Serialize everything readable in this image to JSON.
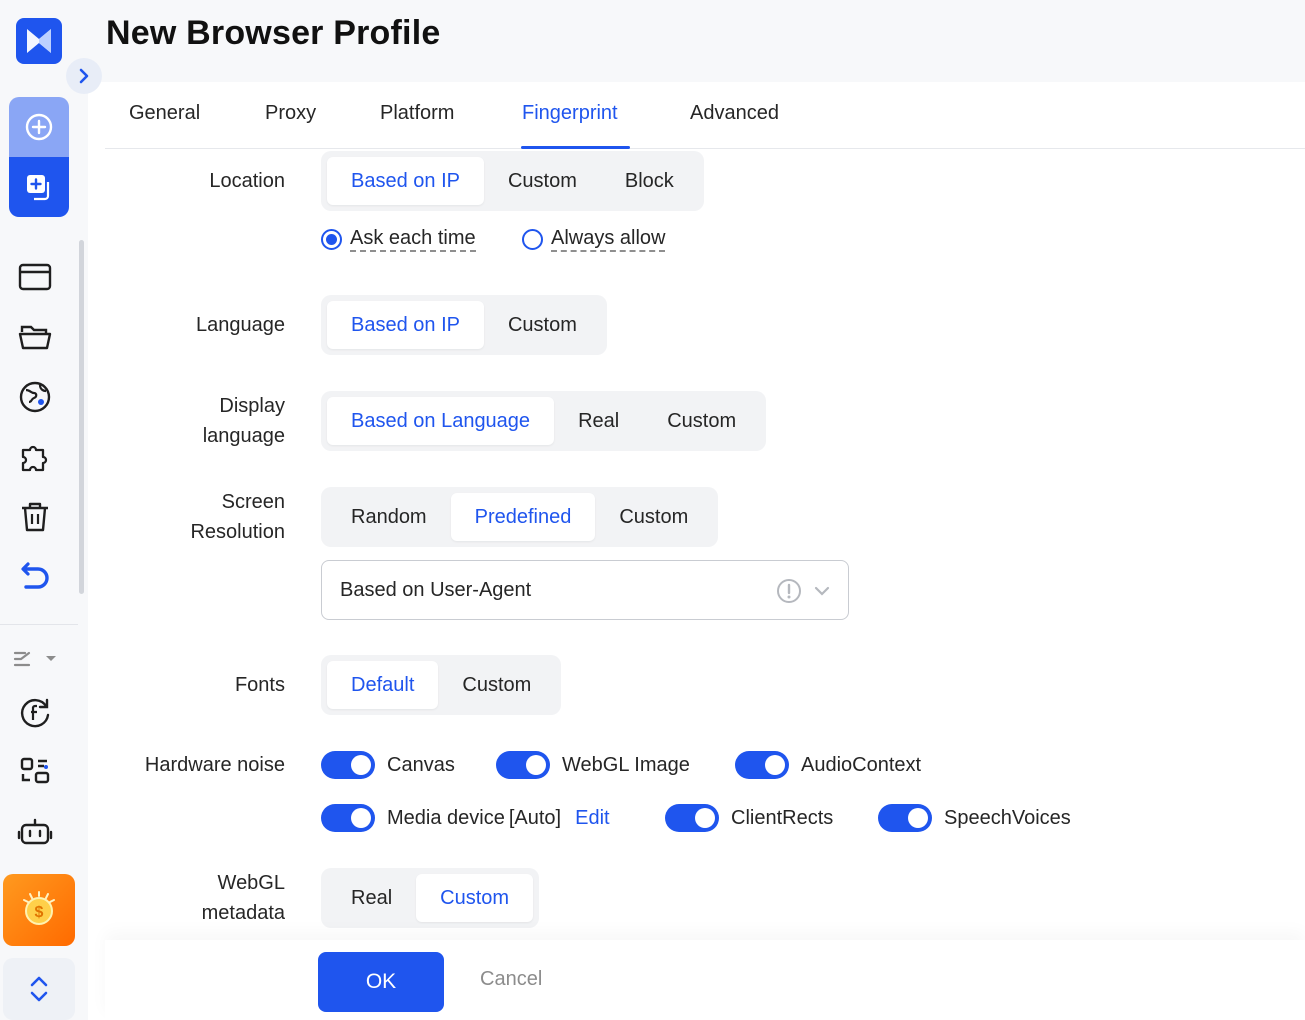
{
  "window": {
    "title": "New Browser Profile"
  },
  "tabs": [
    {
      "label": "General"
    },
    {
      "label": "Proxy"
    },
    {
      "label": "Platform"
    },
    {
      "label": "Fingerprint",
      "active": true
    },
    {
      "label": "Advanced"
    }
  ],
  "location": {
    "label": "Location",
    "options": [
      "Based on IP",
      "Custom",
      "Block"
    ],
    "selected": "Based on IP",
    "permission": {
      "options": [
        "Ask each time",
        "Always allow"
      ],
      "selected": "Ask each time"
    }
  },
  "language": {
    "label": "Language",
    "options": [
      "Based on IP",
      "Custom"
    ],
    "selected": "Based on IP"
  },
  "display_language": {
    "label_line1": "Display",
    "label_line2": "language",
    "options": [
      "Based on Language",
      "Real",
      "Custom"
    ],
    "selected": "Based on Language"
  },
  "screen_resolution": {
    "label_line1": "Screen",
    "label_line2": "Resolution",
    "options": [
      "Random",
      "Predefined",
      "Custom"
    ],
    "selected": "Predefined",
    "dropdown_value": "Based on User-Agent"
  },
  "fonts": {
    "label": "Fonts",
    "options": [
      "Default",
      "Custom"
    ],
    "selected": "Default"
  },
  "hardware_noise": {
    "label": "Hardware noise",
    "toggles": [
      {
        "name": "Canvas",
        "on": true
      },
      {
        "name": "WebGL Image",
        "on": true
      },
      {
        "name": "AudioContext",
        "on": true
      },
      {
        "name": "Media device",
        "suffix": "[Auto]",
        "link": "Edit",
        "on": true
      },
      {
        "name": "ClientRects",
        "on": true
      },
      {
        "name": "SpeechVoices",
        "on": true
      }
    ]
  },
  "webgl_metadata": {
    "label_line1": "WebGL",
    "label_line2": "metadata",
    "options": [
      "Real",
      "Custom"
    ],
    "selected": "Custom"
  },
  "footer": {
    "ok_label": "OK",
    "cancel_label": "Cancel"
  },
  "colors": {
    "accent": "#1f55ee",
    "reward": "#ff7a0f"
  },
  "sidebar_icons": [
    "logo-icon",
    "chevron-right-icon",
    "add-circle-icon",
    "add-profile-icon",
    "browser-window-icon",
    "folder-icon",
    "extension-store-icon",
    "puzzle-icon",
    "trash-icon",
    "sync-icon",
    "automation-icon",
    "facebook-sync-icon",
    "rpa-icon",
    "robot-icon",
    "coin-icon",
    "chevron-updown-icon"
  ]
}
